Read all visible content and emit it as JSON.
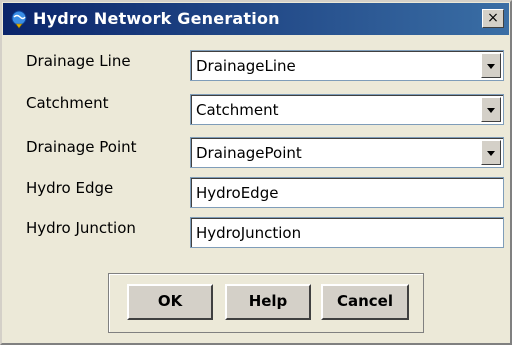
{
  "window": {
    "title": "Hydro Network Generation",
    "close_glyph": "×",
    "icon": "hydro-app-icon"
  },
  "form": {
    "fields": [
      {
        "label": "Drainage Line",
        "value": "DrainageLine",
        "type": "dropdown"
      },
      {
        "label": "Catchment",
        "value": "Catchment",
        "type": "dropdown"
      },
      {
        "label": "Drainage Point",
        "value": "DrainagePoint",
        "type": "dropdown"
      },
      {
        "label": "Hydro Edge",
        "value": "HydroEdge",
        "type": "text"
      },
      {
        "label": "Hydro Junction",
        "value": "HydroJunction",
        "type": "text"
      }
    ]
  },
  "buttons": {
    "ok": "OK",
    "help": "Help",
    "cancel": "Cancel"
  }
}
